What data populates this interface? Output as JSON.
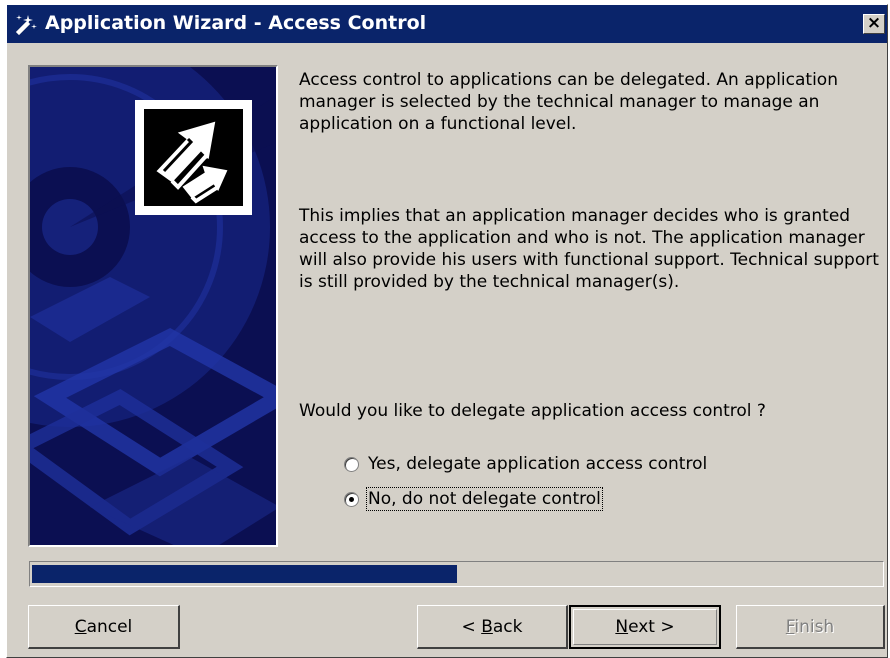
{
  "window": {
    "title": "Application Wizard - Access Control",
    "close_label": "×",
    "title_icon": "wizard-wand-icon"
  },
  "banner": {
    "icon": "shortcut-arrow-icon"
  },
  "content": {
    "paragraph1": "Access control to applications can be delegated. An application manager is selected by the technical manager to manage an application on a functional level.",
    "paragraph2": "This implies that an application manager decides who is granted access to the application and who is not. The application manager will also provide his users with functional support. Technical support is still provided by the technical manager(s).",
    "question": "Would you like to delegate application access control ?",
    "options": [
      {
        "label": "Yes, delegate application access control",
        "selected": false
      },
      {
        "label": "No, do not delegate control",
        "selected": true
      }
    ]
  },
  "progress": {
    "value": 0.5,
    "color": "#0a246a"
  },
  "buttons": {
    "cancel": {
      "label": "Cancel",
      "accel": "C",
      "rest": "ancel"
    },
    "back": {
      "label": "< Back",
      "pre": "< ",
      "accel": "B",
      "rest": "ack"
    },
    "next": {
      "label": "Next >",
      "accel": "N",
      "rest": "ext >"
    },
    "finish": {
      "label": "Finish",
      "accel": "F",
      "rest": "inish",
      "disabled": true
    }
  },
  "colors": {
    "titlebar": "#0a246a",
    "face": "#d4d0c8",
    "banner": "#0b0f52"
  }
}
